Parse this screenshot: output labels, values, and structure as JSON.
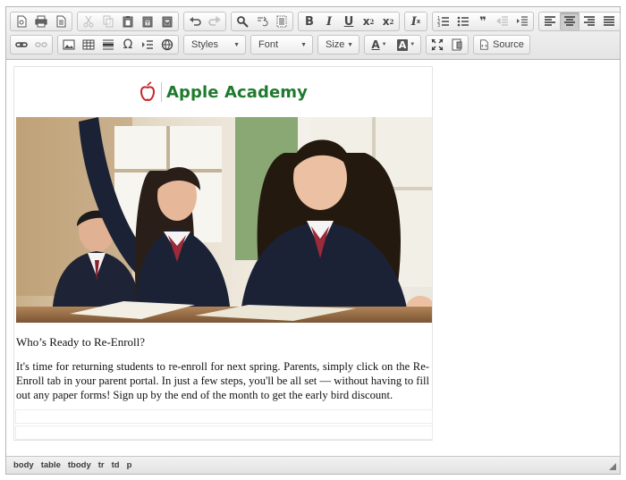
{
  "toolbar": {
    "styles_label": "Styles",
    "font_label": "Font",
    "size_label": "Size",
    "source_label": "Source",
    "bold_glyph": "B",
    "italic_glyph": "I",
    "underline_glyph": "U",
    "subscript_glyph": "x",
    "subscript_mark": "2",
    "superscript_glyph": "x",
    "superscript_mark": "2",
    "remove_format_glyph": "I",
    "remove_format_mark": "x",
    "special_char_glyph": "Ω",
    "blockquote_glyph": "❞",
    "text_color_glyph": "A",
    "bg_color_glyph": "A",
    "icons": [
      "preview-icon",
      "print-icon",
      "templates-icon",
      "cut-icon",
      "copy-icon",
      "paste-icon",
      "paste-text-icon",
      "paste-word-icon",
      "undo-icon",
      "redo-icon",
      "find-icon",
      "replace-icon",
      "select-all-icon",
      "bold-icon",
      "italic-icon",
      "underline-icon",
      "subscript-icon",
      "superscript-icon",
      "remove-format-icon",
      "numbered-list-icon",
      "bulleted-list-icon",
      "blockquote-icon",
      "outdent-icon",
      "indent-icon",
      "align-left-icon",
      "align-center-icon",
      "align-right-icon",
      "justify-icon",
      "link-icon",
      "unlink-icon",
      "image-icon",
      "table-icon",
      "horizontal-rule-icon",
      "special-char-icon",
      "page-break-icon",
      "iframe-icon",
      "text-color-icon",
      "background-color-icon",
      "maximize-icon",
      "show-blocks-icon",
      "source-icon"
    ],
    "active_alignment": "center"
  },
  "document": {
    "logo_text": "Apple Academy",
    "heading": "Who’s Ready to Re-Enroll?",
    "paragraph": "It's time for returning students to re-enroll for next spring. Parents, simply click on the Re-Enroll tab in your parent portal. In just a few steps, you'll be all set — without having to fill out any paper forms! Sign up by the end of the month to get the early bird discount."
  },
  "statusbar": {
    "path": [
      "body",
      "table",
      "tbody",
      "tr",
      "td",
      "p"
    ]
  },
  "colors": {
    "brand_green": "#1f7a2e",
    "apple_red": "#c8262c"
  }
}
